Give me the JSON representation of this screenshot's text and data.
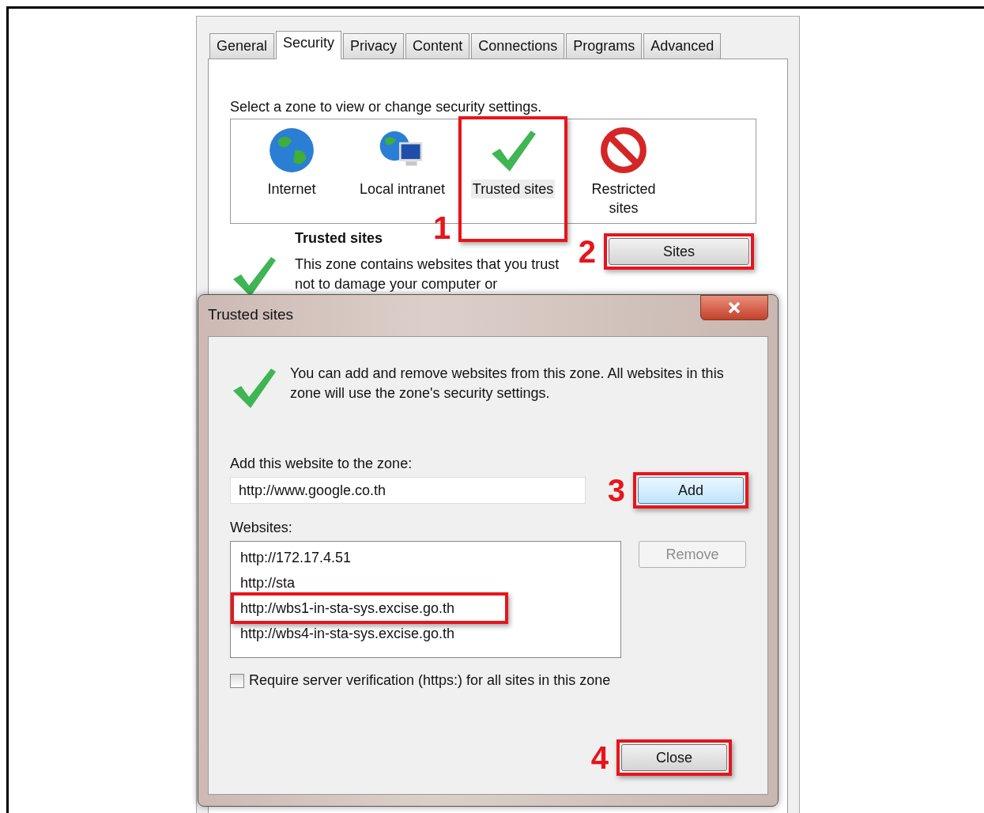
{
  "settings_dialog": {
    "tabs": [
      {
        "label": "General",
        "selected": false
      },
      {
        "label": "Security",
        "selected": true
      },
      {
        "label": "Privacy",
        "selected": false
      },
      {
        "label": "Content",
        "selected": false
      },
      {
        "label": "Connections",
        "selected": false
      },
      {
        "label": "Programs",
        "selected": false
      },
      {
        "label": "Advanced",
        "selected": false
      }
    ],
    "zone_prompt": "Select a zone to view or change security settings.",
    "zones": [
      {
        "label": "Internet",
        "kind": "globe",
        "selected": false,
        "highlighted": false
      },
      {
        "label": "Local intranet",
        "kind": "intranet",
        "selected": false,
        "highlighted": false
      },
      {
        "label": "Trusted sites",
        "kind": "check",
        "selected": true,
        "highlighted": true,
        "step": "1"
      },
      {
        "label": "Restricted sites",
        "kind": "blocked",
        "selected": false,
        "highlighted": false
      }
    ],
    "zone_title": "Trusted sites",
    "zone_description": "This zone contains websites that you trust not to damage your computer or",
    "sites_button": {
      "label": "Sites",
      "highlighted": true,
      "step": "2"
    }
  },
  "trusted_sites_dialog": {
    "title": "Trusted sites",
    "intro": "You can add and remove websites from this zone. All websites in this zone will use the zone's security settings.",
    "add_label": "Add this website to the zone:",
    "add_value": "http://www.google.co.th",
    "add_button": {
      "label": "Add",
      "highlighted": true,
      "step": "3"
    },
    "websites_label": "Websites:",
    "websites": [
      {
        "text": "http://172.17.4.51",
        "highlighted": false
      },
      {
        "text": "http://sta",
        "highlighted": false
      },
      {
        "text": "http://wbs1-in-sta-sys.excise.go.th",
        "highlighted": true
      },
      {
        "text": "http://wbs4-in-sta-sys.excise.go.th",
        "highlighted": false
      }
    ],
    "remove_button": {
      "label": "Remove",
      "disabled": true
    },
    "require_https": {
      "label": "Require server verification (https:) for all sites in this zone",
      "checked": false
    },
    "close_button": {
      "label": "Close",
      "highlighted": true,
      "step": "4"
    }
  }
}
